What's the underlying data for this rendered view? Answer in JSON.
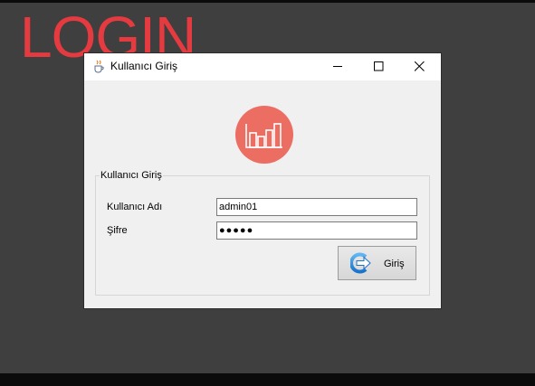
{
  "overlay_title": "LOGIN",
  "window": {
    "title": "Kullanıcı Giriş",
    "icon": "java-cup-icon",
    "controls": [
      "minimize-icon",
      "maximize-icon",
      "close-icon"
    ]
  },
  "logo": {
    "icon": "bar-chart-icon",
    "color": "#ec6e63"
  },
  "form": {
    "group_title": "Kullanıcı Giriş",
    "username_label": "Kullanıcı Adı",
    "username_value": "admin01",
    "password_label": "Şifre",
    "password_masked": "●●●●●",
    "login_button": "Giriş",
    "login_icon": "arrow-right-icon"
  },
  "colors": {
    "desktop_bg": "#403f3f",
    "title_red": "#e53a3f",
    "window_bg": "#f0f0f0"
  }
}
